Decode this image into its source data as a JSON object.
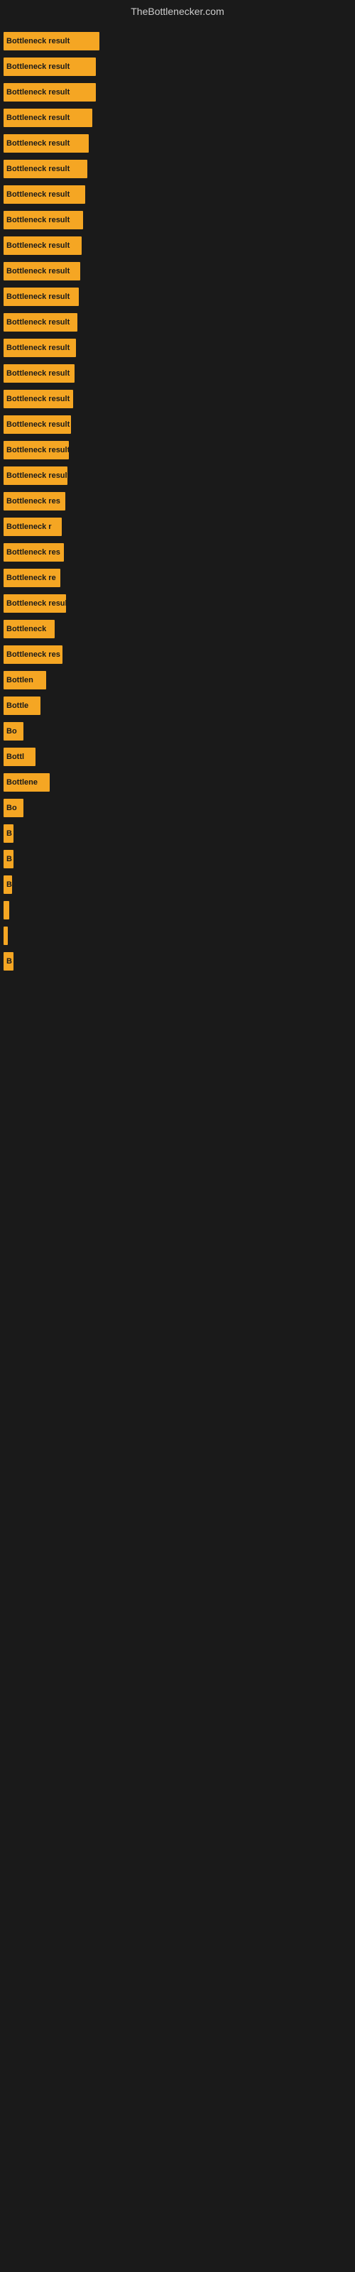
{
  "site_title": "TheBottlenecker.com",
  "bars": [
    {
      "label": "Bottleneck result",
      "width": 135
    },
    {
      "label": "Bottleneck result",
      "width": 130
    },
    {
      "label": "Bottleneck result",
      "width": 130
    },
    {
      "label": "Bottleneck result",
      "width": 125
    },
    {
      "label": "Bottleneck result",
      "width": 120
    },
    {
      "label": "Bottleneck result",
      "width": 118
    },
    {
      "label": "Bottleneck result",
      "width": 115
    },
    {
      "label": "Bottleneck result",
      "width": 112
    },
    {
      "label": "Bottleneck result",
      "width": 110
    },
    {
      "label": "Bottleneck result",
      "width": 108
    },
    {
      "label": "Bottleneck result",
      "width": 106
    },
    {
      "label": "Bottleneck result",
      "width": 104
    },
    {
      "label": "Bottleneck result",
      "width": 102
    },
    {
      "label": "Bottleneck result",
      "width": 100
    },
    {
      "label": "Bottleneck result",
      "width": 98
    },
    {
      "label": "Bottleneck result",
      "width": 95
    },
    {
      "label": "Bottleneck result",
      "width": 92
    },
    {
      "label": "Bottleneck result",
      "width": 90
    },
    {
      "label": "Bottleneck res",
      "width": 87
    },
    {
      "label": "Bottleneck r",
      "width": 82
    },
    {
      "label": "Bottleneck res",
      "width": 85
    },
    {
      "label": "Bottleneck re",
      "width": 80
    },
    {
      "label": "Bottleneck result",
      "width": 88
    },
    {
      "label": "Bottleneck",
      "width": 72
    },
    {
      "label": "Bottleneck res",
      "width": 83
    },
    {
      "label": "Bottlen",
      "width": 60
    },
    {
      "label": "Bottle",
      "width": 52
    },
    {
      "label": "Bo",
      "width": 28
    },
    {
      "label": "Bottl",
      "width": 45
    },
    {
      "label": "Bottlene",
      "width": 65
    },
    {
      "label": "Bo",
      "width": 28
    },
    {
      "label": "B",
      "width": 14
    },
    {
      "label": "B",
      "width": 14
    },
    {
      "label": "B",
      "width": 12
    },
    {
      "label": "",
      "width": 8
    },
    {
      "label": "",
      "width": 6
    },
    {
      "label": "B",
      "width": 14
    }
  ]
}
